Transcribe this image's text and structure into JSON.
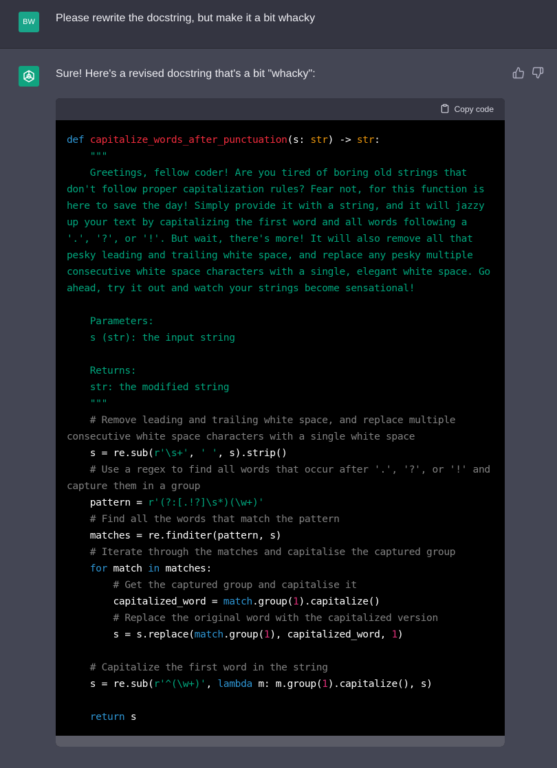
{
  "user_message": {
    "avatar_initials": "BW",
    "text": "Please rewrite the docstring, but make it a bit whacky"
  },
  "assistant_message": {
    "avatar_icon": "openai-logo-icon",
    "intro": "Sure! Here's a revised docstring that's a bit \"whacky\":",
    "thumbs_up_icon": "thumbs-up-icon",
    "thumbs_down_icon": "thumbs-down-icon"
  },
  "code_block": {
    "copy_label": "Copy code",
    "copy_icon": "clipboard-icon",
    "language": "python",
    "lines": [
      "def capitalize_words_after_punctuation(s: str) -> str:",
      "    \"\"\"",
      "    Greetings, fellow coder! Are you tired of boring old strings that",
      "don't follow proper capitalization rules? Fear not, for this function is",
      "here to save the day! Simply provide it with a string, and it will jazzy",
      "up your text by capitalizing the first word and all words following a",
      "'.', '?', or '!'. But wait, there's more! It will also remove all that",
      "pesky leading and trailing white space, and replace any pesky multiple",
      "consecutive white space characters with a single, elegant white space. Go",
      "ahead, try it out and watch your strings become sensational!",
      "",
      "    Parameters:",
      "    s (str): the input string",
      "",
      "    Returns:",
      "    str: the modified string",
      "    \"\"\"",
      "    # Remove leading and trailing white space, and replace multiple",
      "consecutive white space characters with a single white space",
      "    s = re.sub(r'\\s+', ' ', s).strip()",
      "    # Use a regex to find all words that occur after '.', '?', or '!' and",
      "capture them in a group",
      "    pattern = r'(?:[.!?]\\s*)(\\w+)'",
      "    # Find all the words that match the pattern",
      "    matches = re.finditer(pattern, s)",
      "    # Iterate through the matches and capitalise the captured group",
      "    for match in matches:",
      "        # Get the captured group and capitalise it",
      "        capitalized_word = match.group(1).capitalize()",
      "        # Replace the original word with the capitalized version",
      "        s = s.replace(match.group(1), capitalized_word, 1)",
      "",
      "    # Capitalize the first word in the string",
      "    s = re.sub(r'^(\\w+)', lambda m: m.group(1).capitalize(), s)",
      "",
      "    return s"
    ]
  },
  "colors": {
    "page_bg": "#444654",
    "user_row_bg": "#343541",
    "code_bg": "#000000",
    "keyword": "#2e95d3",
    "function_name": "#f22c3d",
    "type": "#e9950c",
    "string": "#00a67d",
    "number": "#df3079",
    "user_avatar": "#19a589",
    "bot_avatar": "#10a37f"
  }
}
